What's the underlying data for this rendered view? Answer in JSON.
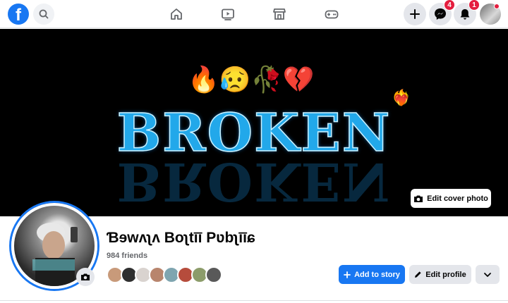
{
  "topbar": {
    "logo": "f",
    "messenger_badge": "4",
    "notifications_badge": "1"
  },
  "cover": {
    "title": "BROKEN",
    "emojis": "🔥😥🥀💔",
    "hearts": "❤️‍🔥",
    "edit_cover_label": "Edit cover photo"
  },
  "profile": {
    "name": "Ɓɘwʌʅʌ Boʅtīī Pʋbʅīīɕ",
    "friends": "984 friends",
    "friend_avatar_colors": [
      "#c89a7a",
      "#2f2f2f",
      "#d9d3cf",
      "#b8856d",
      "#7fa5b0",
      "#b64c3c",
      "#8c9c6a",
      "#595959"
    ]
  },
  "actions": {
    "add_story_label": "Add to story",
    "edit_profile_label": "Edit profile"
  },
  "colors": {
    "brand": "#1877f2",
    "badge": "#e41e3f"
  }
}
